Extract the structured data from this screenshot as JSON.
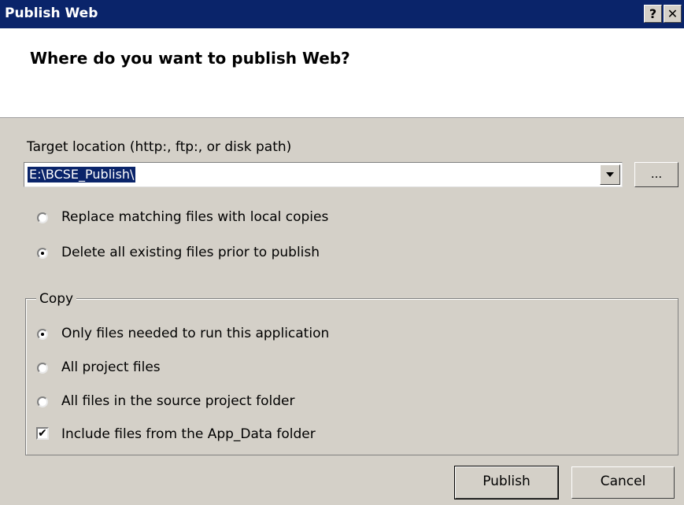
{
  "window": {
    "title": "Publish Web",
    "help_button": "?",
    "close_button": "✕"
  },
  "header": {
    "question": "Where do you want to publish Web?"
  },
  "target": {
    "label": "Target location (http:, ftp:, or disk path)",
    "value": "E:\\BCSE_Publish\\",
    "browse_label": "..."
  },
  "publish_mode": {
    "options": [
      {
        "label": "Replace matching files with local copies",
        "selected": false
      },
      {
        "label": "Delete all existing files prior to publish",
        "selected": true
      }
    ]
  },
  "copy": {
    "legend": "Copy",
    "options": [
      {
        "label": "Only files needed to run this application",
        "selected": true
      },
      {
        "label": "All project files",
        "selected": false
      },
      {
        "label": "All files in the source project folder",
        "selected": false
      }
    ],
    "include_app_data": {
      "label": "Include files from the App_Data folder",
      "checked": true
    }
  },
  "buttons": {
    "publish": "Publish",
    "cancel": "Cancel"
  }
}
